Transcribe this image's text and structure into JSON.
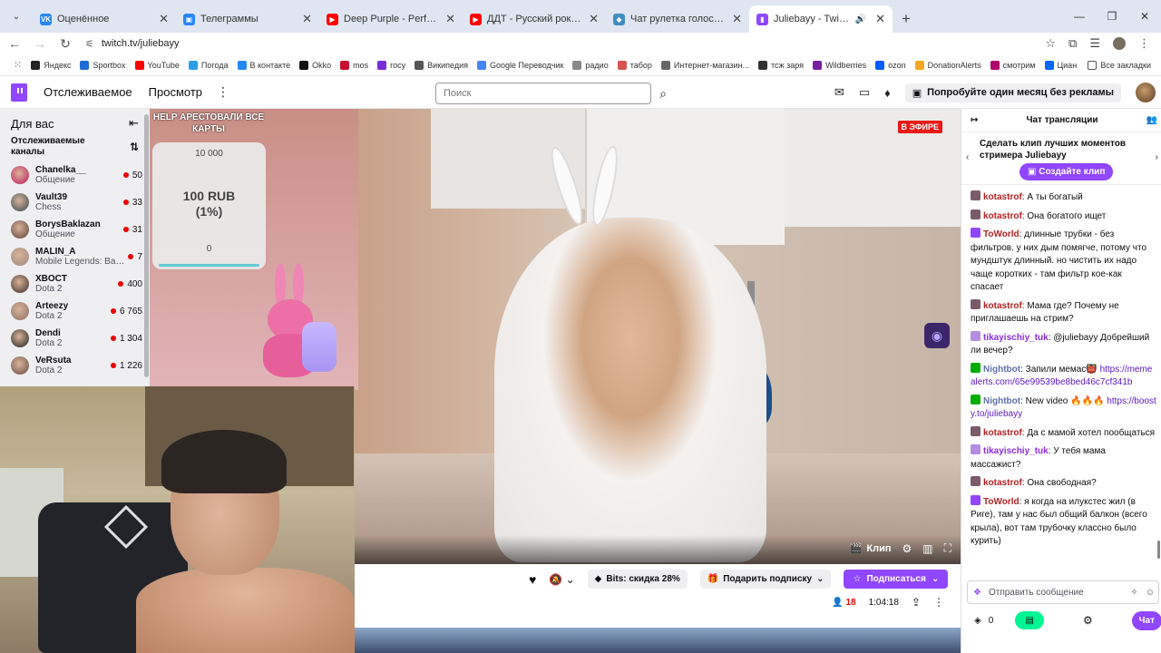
{
  "browser": {
    "tabs": [
      {
        "title": "Оценённое",
        "color": "#2787f5",
        "glyph": "VK",
        "active": false
      },
      {
        "title": "Телеграммы",
        "color": "#2787f5",
        "glyph": "▣",
        "active": false
      },
      {
        "title": "Deep Purple - Perfect Strangers",
        "color": "#ff0000",
        "glyph": "▶",
        "active": false
      },
      {
        "title": "ДДТ - Русский рок (Аудио) - YouTube",
        "color": "#ff0000",
        "glyph": "▶",
        "active": false
      },
      {
        "title": "Чат рулетка голосовая — Nekto.me",
        "color": "#3f8fbf",
        "glyph": "◆",
        "active": false
      },
      {
        "title": "Juliebayy - Twitch",
        "color": "#9146ff",
        "glyph": "▮",
        "active": true
      }
    ],
    "url": "twitch.tv/juliebayy",
    "bookmarks": [
      {
        "label": "Яндекс",
        "color": "#222"
      },
      {
        "label": "Sportbox",
        "color": "#1e6bd6"
      },
      {
        "label": "YouTube",
        "color": "#ff0000"
      },
      {
        "label": "Погода",
        "color": "#2aa0e8"
      },
      {
        "label": "В контакте",
        "color": "#2787f5"
      },
      {
        "label": "Okko",
        "color": "#111"
      },
      {
        "label": "mos",
        "color": "#c8102e"
      },
      {
        "label": "rocy",
        "color": "#7a2cd6"
      },
      {
        "label": "Википедия",
        "color": "#555"
      },
      {
        "label": "Google Переводчик",
        "color": "#4285f4"
      },
      {
        "label": "радио",
        "color": "#888"
      },
      {
        "label": "табор",
        "color": "#d9534f"
      },
      {
        "label": "Интернет-магазин...",
        "color": "#666"
      },
      {
        "label": "тсж заря",
        "color": "#333"
      },
      {
        "label": "Wildberries",
        "color": "#7b1fa2"
      },
      {
        "label": "ozon",
        "color": "#005bff"
      },
      {
        "label": "DonationAlerts",
        "color": "#f5a623"
      },
      {
        "label": "смотрим",
        "color": "#b0006d"
      },
      {
        "label": "Циан",
        "color": "#0468ff"
      }
    ],
    "all_bookmarks": "Все закладки"
  },
  "twitch_nav": {
    "following": "Отслеживаемое",
    "browse": "Просмотр",
    "search_placeholder": "Поиск",
    "promo": "Попробуйте один месяц без рекламы"
  },
  "sidebar": {
    "for_you": "Для вас",
    "followed_channels": "Отслеживаемые каналы",
    "channels": [
      {
        "name": "Chanelka__",
        "game": "Общение",
        "viewers": "50",
        "color": "#c2185b"
      },
      {
        "name": "Vault39",
        "game": "Chess",
        "viewers": "33",
        "color": "#37474f"
      },
      {
        "name": "BorysBaklazan",
        "game": "Общение",
        "viewers": "31",
        "color": "#5d4037"
      },
      {
        "name": "MALIN_A",
        "game": "Mobile Legends: Bang Bang",
        "viewers": "7",
        "color": "#a1887f"
      },
      {
        "name": "XBOCT",
        "game": "Dota 2",
        "viewers": "400",
        "color": "#3e2723"
      },
      {
        "name": "Arteezy",
        "game": "Dota 2",
        "viewers": "6 765",
        "color": "#8d6e63"
      },
      {
        "name": "Dendi",
        "game": "Dota 2",
        "viewers": "1 304",
        "color": "#212121"
      },
      {
        "name": "VeRsuta",
        "game": "Dota 2",
        "viewers": "1 226",
        "color": "#6d4c41"
      }
    ]
  },
  "stream": {
    "live_badge": "В ЭФИРЕ",
    "donation": {
      "title": "HELP АРЕСТОВАЛИ ВСЕ КАРТЫ",
      "goal": "10 000",
      "amount": "100 RUB",
      "percent": "(1%)",
      "min": "0",
      "progress": 0.01
    },
    "clip_label": "Клип"
  },
  "info_bar": {
    "bits": "Bits: скидка 28%",
    "gift_sub": "Подарить подписку",
    "subscribe": "Подписаться",
    "viewers": "18",
    "uptime": "1:04:18"
  },
  "chat": {
    "header": "Чат трансляции",
    "clip_promo": "Сделать клип лучших моментов стримера Juliebayy",
    "clip_button": "Создайте клип",
    "input_placeholder": "Отправить сообщение",
    "points": "0",
    "send": "Чат",
    "messages": [
      {
        "user": "kotastrof",
        "color": "#b22222",
        "badge": "#7d5a6a",
        "text": " А ты богатый",
        "link": ""
      },
      {
        "user": "kotastrof",
        "color": "#b22222",
        "badge": "#7d5a6a",
        "text": " Она богатого ищет",
        "link": ""
      },
      {
        "user": "ToWorld",
        "color": "#b22222",
        "badge": "#9146ff",
        "text": " длинные трубки - без фильтров. у них дым помягче, потому что мундштук длинный. но чистить их надо чаще коротких - там фильтр кое-как спасает",
        "link": ""
      },
      {
        "user": "kotastrof",
        "color": "#b22222",
        "badge": "#7d5a6a",
        "text": " Мама где? Почему не приглашаешь на стрим?",
        "link": ""
      },
      {
        "user": "tikayischiy_tuk",
        "color": "#8a2be2",
        "badge": "#b58ce0",
        "text": " @juliebayy Добрейший ли вечер?",
        "link": ""
      },
      {
        "user": "Nightbot",
        "color": "#5f6fa8",
        "badge": "#00ad03",
        "text": " Запили мемас👹",
        "link": "https://memealerts.com/65e99539be8bed46c7cf341b"
      },
      {
        "user": "Nightbot",
        "color": "#5f6fa8",
        "badge": "#00ad03",
        "text": " New video 🔥🔥🔥",
        "link": "https://boosty.to/juliebayy"
      },
      {
        "user": "kotastrof",
        "color": "#b22222",
        "badge": "#7d5a6a",
        "text": " Да с мамой хотел пообщаться",
        "link": ""
      },
      {
        "user": "tikayischiy_tuk",
        "color": "#8a2be2",
        "badge": "#b58ce0",
        "text": " У тебя мама массажист?",
        "link": ""
      },
      {
        "user": "kotastrof",
        "color": "#b22222",
        "badge": "#7d5a6a",
        "text": " Она свободная?",
        "link": ""
      },
      {
        "user": "ToWorld",
        "color": "#b22222",
        "badge": "#9146ff",
        "text": " я когда на илукстес жил (в Риге), там у нас был общий балкон (всего крыла), вот там трубочку классно было курить)",
        "link": ""
      }
    ]
  },
  "accent": "#9146ff",
  "live_color": "#eb0400"
}
